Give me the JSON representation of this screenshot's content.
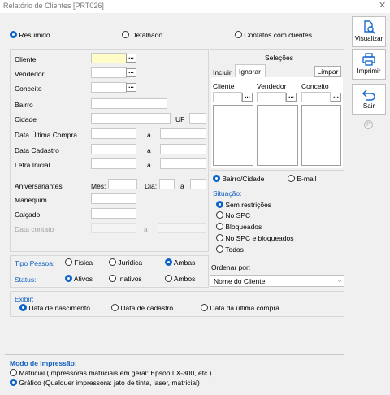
{
  "window": {
    "title": "Relatório de Clientes [PRT026]"
  },
  "report_type": {
    "options": [
      "Resumido",
      "Detalhado",
      "Contatos com clientes"
    ],
    "selected": "Resumido"
  },
  "filters": {
    "cliente": "Cliente",
    "vendedor": "Vendedor",
    "conceito": "Conceito",
    "bairro": "Bairro",
    "cidade": "Cidade",
    "uf": "UF",
    "data_ultima_compra": "Data Última Compra",
    "data_cadastro": "Data Cadastro",
    "letra_inicial": "Letra Inicial",
    "a": "a",
    "aniversariantes": "Aniversariantes",
    "mes": "Mês:",
    "dia": "Dia:",
    "manequim": "Manequim",
    "calcado": "Calçado",
    "data_contato": "Data contato",
    "lookup_button": "..."
  },
  "selecoes": {
    "title": "Seleções",
    "tabs": [
      "Incluir",
      "Ignorar"
    ],
    "active_tab": "Ignorar",
    "clear_button": "Limpar",
    "columns": [
      "Cliente",
      "Vendedor",
      "Conceito"
    ]
  },
  "location_mode": {
    "options": [
      "Bairro/Cidade",
      "E-mail"
    ],
    "selected": "Bairro/Cidade"
  },
  "situacao": {
    "title": "Situação:",
    "options": [
      "Sem restrições",
      "No SPC",
      "Bloqueados",
      "No SPC e bloqueados",
      "Todos"
    ],
    "selected": "Sem restrições"
  },
  "tipo_pessoa": {
    "label": "Tipo Pessoa:",
    "options": [
      "Física",
      "Jurídica",
      "Ambas"
    ],
    "selected": "Ambas"
  },
  "status": {
    "label": "Status:",
    "options": [
      "Ativos",
      "Inativos",
      "Ambos"
    ],
    "selected": "Ativos"
  },
  "ordenar": {
    "label": "Ordenar por:",
    "value": "Nome do Cliente"
  },
  "exibir": {
    "label": "Exibir:",
    "options": [
      "Data de nascimento",
      "Data de cadastro",
      "Data da última compra"
    ],
    "selected": "Data de nascimento"
  },
  "modo_impressao": {
    "title": "Modo de Impressão:",
    "options": [
      "Matricial (Impressoras matriciais em geral: Epson LX-300, etc.)",
      "Gráfico (Qualquer impressora: jato de tinta, laser, matricial)"
    ],
    "selected": "Gráfico (Qualquer impressora: jato de tinta, laser, matricial)"
  },
  "sidebar": {
    "visualizar": "Visualizar",
    "imprimir": "Imprimir",
    "sair": "Sair",
    "help": "P"
  },
  "colors": {
    "accent": "#0a64c8",
    "section_label": "#1060c0",
    "highlight_field": "#fffcc8"
  }
}
